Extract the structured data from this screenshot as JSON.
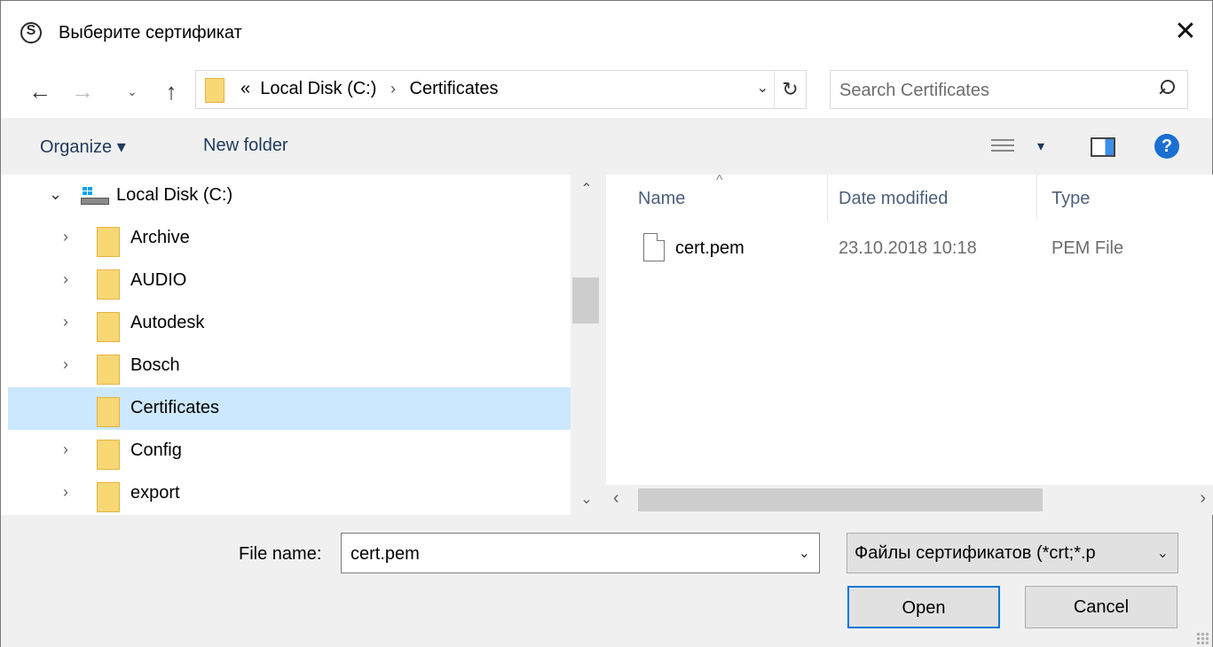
{
  "window": {
    "title": "Выберите сертификат",
    "close_glyph": "✕"
  },
  "nav": {
    "back_glyph": "←",
    "forward_glyph": "→",
    "recent_glyph": "⌄",
    "up_glyph": "↑"
  },
  "address": {
    "prefix": "«",
    "segments": [
      "Local Disk (C:)",
      "Certificates"
    ],
    "separator": "›",
    "dropdown_glyph": "⌄",
    "refresh_glyph": "↻"
  },
  "search": {
    "placeholder": "Search Certificates",
    "value": ""
  },
  "toolbar": {
    "organize_label": "Organize ▾",
    "new_folder_label": "New folder",
    "view_caret": "▾",
    "help_glyph": "?"
  },
  "tree": {
    "root": {
      "label": "Local Disk (C:)",
      "chevron": "⌄"
    },
    "items": [
      {
        "label": "Archive",
        "chevron": "›"
      },
      {
        "label": "AUDIO",
        "chevron": "›"
      },
      {
        "label": "Autodesk",
        "chevron": "›"
      },
      {
        "label": "Bosch",
        "chevron": "›"
      },
      {
        "label": "Certificates",
        "chevron": ""
      },
      {
        "label": "Config",
        "chevron": "›"
      },
      {
        "label": "export",
        "chevron": "›"
      }
    ],
    "selected_index": 4
  },
  "filelist": {
    "columns": {
      "name": "Name",
      "date": "Date modified",
      "type": "Type"
    },
    "sort_glyph": "^",
    "files": [
      {
        "name": "cert.pem",
        "date": "23.10.2018 10:18",
        "type": "PEM File"
      }
    ]
  },
  "scroll": {
    "up": "⌃",
    "down": "⌄",
    "left": "‹",
    "right": "›"
  },
  "footer": {
    "file_name_label": "File name:",
    "file_name_value": "cert.pem",
    "dropdown_glyph": "⌄",
    "filter_label": "Файлы сертификатов  (*crt;*.p",
    "open_label": "Open",
    "cancel_label": "Cancel"
  },
  "colors": {
    "selected_row": "#cce8ff",
    "accent": "#0078d7",
    "toolbar_bg": "#f0f0f0",
    "folder": "#f8d775",
    "help": "#1a6fd1"
  },
  "icons": [
    "app-icon",
    "close-icon",
    "back-arrow-icon",
    "forward-arrow-icon",
    "up-arrow-icon",
    "folder-icon",
    "refresh-icon",
    "search-icon",
    "view-options-icon",
    "preview-pane-icon",
    "help-icon",
    "drive-icon",
    "file-icon"
  ]
}
